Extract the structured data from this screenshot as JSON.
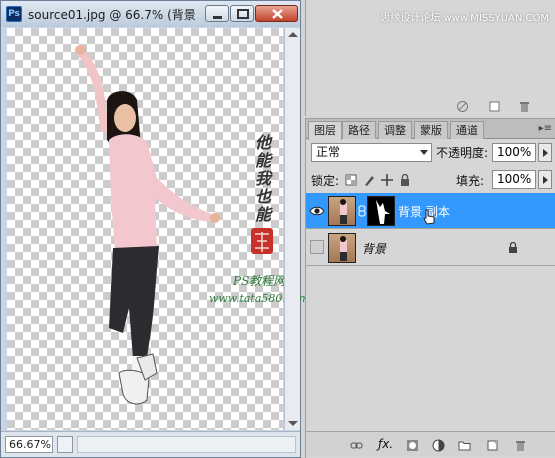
{
  "document": {
    "app_icon": "Ps",
    "title": "source01.jpg @ 66.7% (背景",
    "zoom": "66.67%"
  },
  "site_watermark": "思缘设计论坛 www.MISSYUAN.COM",
  "photo_watermark": {
    "site_name": "PS教程网",
    "url": "www.tata580.com",
    "calligraphy": "他能我也能"
  },
  "layers_panel": {
    "tabs": [
      "图层",
      "路径",
      "调整",
      "蒙版",
      "通道"
    ],
    "active_tab": 0,
    "blend_mode": "正常",
    "opacity_label": "不透明度:",
    "opacity_value": "100%",
    "lock_label": "锁定:",
    "fill_label": "填充:",
    "fill_value": "100%",
    "layers": [
      {
        "name": "背景 副本",
        "visible": true,
        "selected": true,
        "has_mask": true,
        "locked": false
      },
      {
        "name": "背景",
        "visible": false,
        "selected": false,
        "has_mask": false,
        "locked": true
      }
    ]
  },
  "colors": {
    "selection": "#3399ff",
    "panel_bg": "#d6d6d6",
    "title_bar": "#c6d4e4"
  }
}
